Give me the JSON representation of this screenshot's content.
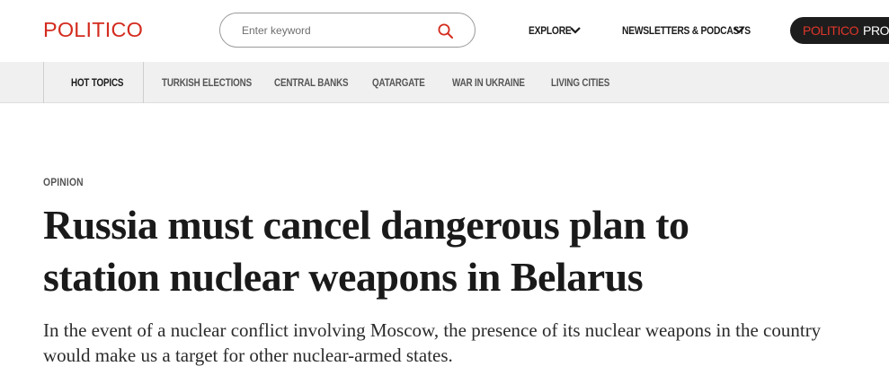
{
  "brand": {
    "logo": "POLITICO",
    "accent_color": "#d32b1e"
  },
  "search": {
    "placeholder": "Enter keyword"
  },
  "nav": {
    "explore_label": "EXPLORE",
    "newsletters_label": "NEWSLETTERS & PODCASTS",
    "pro": {
      "part1": "POLITICO",
      "part2": "PRO"
    }
  },
  "topics": {
    "hot_label": "HOT TOPICS",
    "items": [
      "TURKISH ELECTIONS",
      "CENTRAL BANKS",
      "QATARGATE",
      "WAR IN UKRAINE",
      "LIVING CITIES"
    ]
  },
  "article": {
    "kicker": "OPINION",
    "headline_line1": "Russia must cancel dangerous plan to",
    "headline_line2": "station nuclear weapons in Belarus",
    "dek_line1": "In the event of a nuclear conflict involving Moscow, the presence of its nuclear weapons in the country",
    "dek_line2": "would make us a target for other nuclear-armed states."
  }
}
